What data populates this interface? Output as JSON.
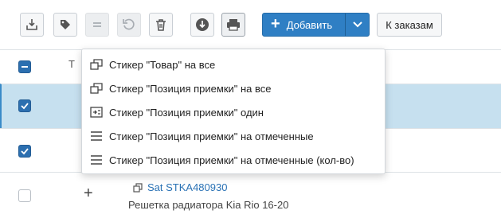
{
  "toolbar": {
    "buttons": [
      {
        "name": "import-icon"
      },
      {
        "name": "tag-icon"
      },
      {
        "name": "equals-icon"
      },
      {
        "name": "undo-icon"
      },
      {
        "name": "trash-icon"
      },
      {
        "name": "download-icon"
      },
      {
        "name": "print-icon"
      }
    ],
    "add_label": "Добавить",
    "orders_label": "К заказам"
  },
  "menu": {
    "items": [
      {
        "label": "Стикер \"Товар\" на все",
        "icon": "copy-icon"
      },
      {
        "label": "Стикер \"Позиция приемки\" на все",
        "icon": "copy-icon"
      },
      {
        "label": "Стикер \"Позиция приемки\" один",
        "icon": "single-sticker-icon"
      },
      {
        "label": "Стикер \"Позиция приемки\" на отмеченные",
        "icon": "list-icon"
      },
      {
        "label": "Стикер \"Позиция приемки\" на отмеченные (кол-во)",
        "icon": "list-icon"
      }
    ]
  },
  "table": {
    "partial_header_char": "Т",
    "item": {
      "code": "Sat STKA480930",
      "description": "Решетка радиатора Kia Rio 16-20"
    }
  },
  "colors": {
    "accent": "#2f7fc4",
    "selected_row": "#c6e0ef",
    "checkbox": "#2c6fb0"
  }
}
